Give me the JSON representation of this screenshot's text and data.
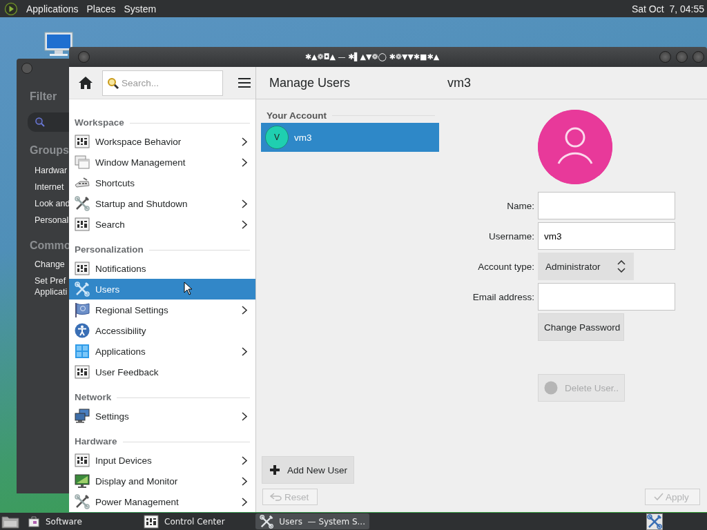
{
  "top_panel": {
    "menus": [
      "Applications",
      "Places",
      "System"
    ],
    "clock": "Sat Oct  7, 04:55"
  },
  "background_window": {
    "filter_label": "Filter",
    "groups_heading": "Groups",
    "groups": [
      "Hardwar",
      "Internet",
      "Look and",
      "Personal"
    ],
    "common_heading": "Commo",
    "common": [
      {
        "lines": [
          "Change"
        ]
      },
      {
        "lines": [
          "Set Pref",
          "Applicati"
        ]
      }
    ]
  },
  "window": {
    "title": "✱▲❁◘▲ — ✱▌▲▼❁◯ ✱❁▼▼✱■✱▲",
    "sidebar": {
      "search": {
        "placeholder": "Search..."
      },
      "sections": [
        {
          "title": "Workspace",
          "items": [
            {
              "label": "Workspace Behavior",
              "kind": "panel",
              "expandable": true,
              "selected": false
            },
            {
              "label": "Window Management",
              "kind": "windows",
              "expandable": true,
              "selected": false
            },
            {
              "label": "Shortcuts",
              "kind": "shortcuts",
              "expandable": false,
              "selected": false
            },
            {
              "label": "Startup and Shutdown",
              "kind": "tools",
              "expandable": true,
              "selected": false
            },
            {
              "label": "Search",
              "kind": "panel",
              "expandable": true,
              "selected": false
            }
          ]
        },
        {
          "title": "Personalization",
          "items": [
            {
              "label": "Notifications",
              "kind": "panel",
              "expandable": false,
              "selected": false
            },
            {
              "label": "Users",
              "kind": "tools",
              "expandable": false,
              "selected": true
            },
            {
              "label": "Regional Settings",
              "kind": "flag",
              "expandable": true,
              "selected": false
            },
            {
              "label": "Accessibility",
              "kind": "accessibility",
              "expandable": false,
              "selected": false
            },
            {
              "label": "Applications",
              "kind": "apps",
              "expandable": true,
              "selected": false
            },
            {
              "label": "User Feedback",
              "kind": "panel",
              "expandable": false,
              "selected": false
            }
          ]
        },
        {
          "title": "Network",
          "items": [
            {
              "label": "Settings",
              "kind": "network",
              "expandable": true,
              "selected": false
            }
          ]
        },
        {
          "title": "Hardware",
          "items": [
            {
              "label": "Input Devices",
              "kind": "panel",
              "expandable": true,
              "selected": false
            },
            {
              "label": "Display and Monitor",
              "kind": "display",
              "expandable": true,
              "selected": false
            },
            {
              "label": "Power Management",
              "kind": "tools",
              "expandable": true,
              "selected": false
            }
          ]
        }
      ]
    },
    "header": {
      "title": "Manage Users",
      "user": "vm3"
    },
    "accounts": {
      "heading": "Your Account",
      "users": [
        {
          "initial": "V",
          "name": "vm3",
          "selected": true
        }
      ]
    },
    "form": {
      "fields": [
        {
          "label": "Name:",
          "kind": "text"
        },
        {
          "label": "Username:",
          "kind": "text",
          "value": "vm3"
        },
        {
          "label": "Account type:",
          "kind": "combo",
          "value": "Administrator"
        },
        {
          "label": "Email address:",
          "kind": "text"
        }
      ],
      "change_password": {
        "label": "Change Password",
        "disabled": false
      },
      "delete_user": {
        "label": "Delete User..",
        "disabled": true
      }
    },
    "add_user": {
      "label": "Add New User",
      "disabled": false
    },
    "reset": {
      "label": "Reset",
      "disabled": true
    },
    "apply": {
      "label": "Apply",
      "disabled": true
    }
  },
  "taskbar": {
    "items": [
      {
        "label": "Software",
        "kind": "bag",
        "active": false
      },
      {
        "label": "Control Center",
        "kind": "panel",
        "active": false
      },
      {
        "label": "Users  — System S...",
        "kind": "tools",
        "active": true
      }
    ]
  }
}
